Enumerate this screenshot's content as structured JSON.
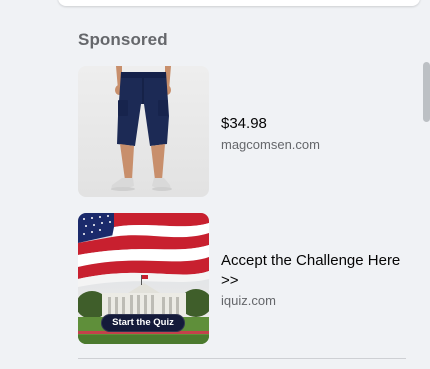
{
  "sidebar": {
    "section_title": "Sponsored",
    "ads": [
      {
        "title": "$34.98",
        "domain": "magcomsen.com",
        "image_desc": "shorts-product-photo"
      },
      {
        "title_line1": "Accept the Challenge Here",
        "title_line2": ">>",
        "domain": "iquiz.com",
        "image_button": "Start the Quiz"
      }
    ]
  },
  "colors": {
    "background": "#f0f2f5",
    "title_text": "#050505",
    "secondary_text": "#65676b",
    "scrollbar": "#bcc0c4"
  }
}
